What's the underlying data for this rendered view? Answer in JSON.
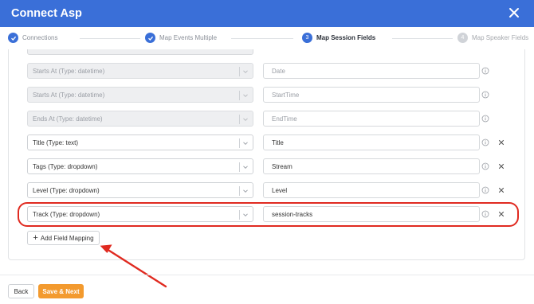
{
  "window": {
    "title": "Connect Asp"
  },
  "colors": {
    "accent": "#3a6fd8",
    "primary_button": "#f39a2e",
    "annotation": "#e02a20"
  },
  "icons": {
    "close": "close-icon",
    "check": "check-icon",
    "chevron": "chevron-down-icon",
    "info": "info-icon",
    "remove": "remove-x-icon",
    "plus": "plus-icon"
  },
  "steps": [
    {
      "label": "Connections",
      "state": "done"
    },
    {
      "label": "Map Events Multiple",
      "state": "done"
    },
    {
      "number": "3",
      "label": "Map Session Fields",
      "state": "active"
    },
    {
      "number": "4",
      "label": "Map Speaker Fields",
      "state": "todo"
    }
  ],
  "mappings": [
    {
      "source": "Starts At (Type: datetime)",
      "target": "Date",
      "disabled": true,
      "removable": false
    },
    {
      "source": "Starts At (Type: datetime)",
      "target": "StartTime",
      "disabled": true,
      "removable": false
    },
    {
      "source": "Ends At (Type: datetime)",
      "target": "EndTime",
      "disabled": true,
      "removable": false
    },
    {
      "source": "Title (Type: text)",
      "target": "Title",
      "disabled": false,
      "removable": true
    },
    {
      "source": "Tags (Type: dropdown)",
      "target": "Stream",
      "disabled": false,
      "removable": true
    },
    {
      "source": "Level (Type: dropdown)",
      "target": "Level",
      "disabled": false,
      "removable": true
    },
    {
      "source": "Track (Type: dropdown)",
      "target": "session-tracks",
      "disabled": false,
      "removable": true,
      "highlighted": true
    }
  ],
  "actions": {
    "add_mapping": "Add Field Mapping",
    "back": "Back",
    "next": "Save & Next"
  }
}
